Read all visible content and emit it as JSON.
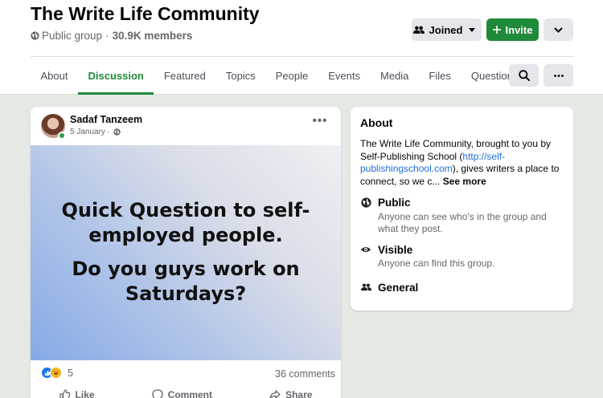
{
  "group": {
    "name": "The Write Life Community",
    "privacy": "Public group",
    "separator": "·",
    "members": "30.9K members"
  },
  "actions": {
    "joined_label": "Joined",
    "invite_label": "Invite"
  },
  "tabs": [
    {
      "label": "About"
    },
    {
      "label": "Discussion",
      "active": true
    },
    {
      "label": "Featured"
    },
    {
      "label": "Topics"
    },
    {
      "label": "People"
    },
    {
      "label": "Events"
    },
    {
      "label": "Media"
    },
    {
      "label": "Files"
    },
    {
      "label": "Questions"
    }
  ],
  "post": {
    "author": "Sadaf Tanzeem",
    "date": "5 January",
    "date_separator": "·",
    "menu": "•••",
    "image_text_line1": "Quick Question to self-employed people.",
    "image_text_line2": "Do you guys work on Saturdays?",
    "reaction_count": "5",
    "comments": "36 comments",
    "like_label": "Like",
    "comment_label": "Comment",
    "share_label": "Share"
  },
  "about": {
    "title": "About",
    "description_start": "The Write Life Community, brought to you by Self-Publishing School (",
    "description_link": "http://self-publishingschool.com",
    "description_end": "), gives writers a place to connect, so we c...",
    "see_more": "See more",
    "public_title": "Public",
    "public_sub": "Anyone can see who's in the group and what they post.",
    "visible_title": "Visible",
    "visible_sub": "Anyone can find this group.",
    "general_title": "General"
  },
  "colors": {
    "accent": "#1f8a3a",
    "link": "#216fdb",
    "page_background": "#e4e9e4"
  },
  "icons": [
    "globe-icon",
    "people-icon",
    "plus-icon",
    "chevron-down-icon",
    "search-icon",
    "ellipsis-icon",
    "eye-icon",
    "like-icon",
    "haha-icon",
    "comment-icon",
    "share-icon"
  ]
}
